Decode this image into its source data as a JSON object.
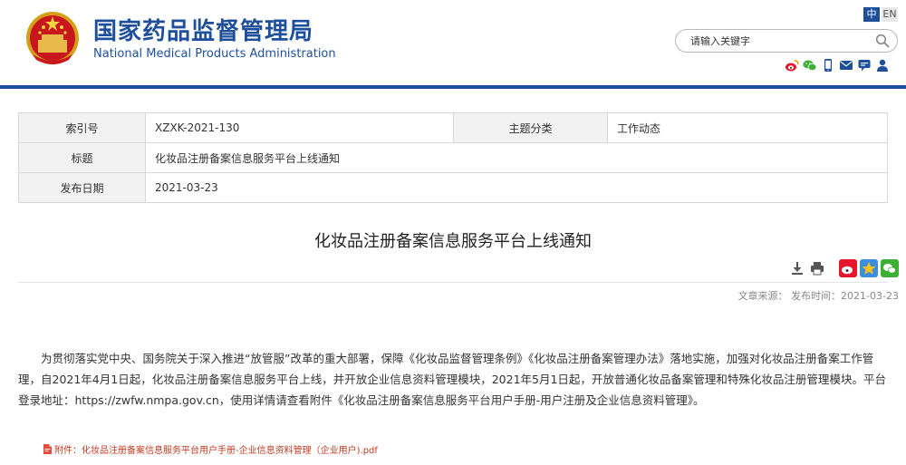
{
  "header": {
    "title_cn": "国家药品监督管理局",
    "title_en": "National Medical Products Administration",
    "lang_zh": "中",
    "lang_en": "EN",
    "search_placeholder": "请输入关键字",
    "social_icons": [
      "weibo-icon",
      "wechat-icon",
      "mobile-icon",
      "mail-icon",
      "feedback-icon",
      "person-icon"
    ]
  },
  "info": {
    "index_label": "索引号",
    "index_value": "XZXK-2021-130",
    "category_label": "主题分类",
    "category_value": "工作动态",
    "title_label": "标题",
    "title_value": "化妆品注册备案信息服务平台上线通知",
    "date_label": "发布日期",
    "date_value": "2021-03-23"
  },
  "article": {
    "title": "化妆品注册备案信息服务平台上线通知",
    "meta": "文章来源：  发布时间：2021-03-23",
    "body": "为贯彻落实党中央、国务院关于深入推进“放管服”改革的重大部署，保障《化妆品监督管理条例》《化妆品注册备案管理办法》落地实施，加强对化妆品注册备案工作管理，自2021年4月1日起，化妆品注册备案信息服务平台上线，并开放企业信息资料管理模块，2021年5月1日起，开放普通化妆品备案管理和特殊化妆品注册管理模块。平台登录地址：https://zwfw.nmpa.gov.cn，使用详情请查看附件《化妆品注册备案信息服务平台用户手册-用户注册及企业信息资料管理》。",
    "attachment": "附件：化妆品注册备案信息服务平台用户手册-企业信息资料管理（企业用户).pdf"
  },
  "colors": {
    "brand_blue": "#1d4f9b",
    "attachment_red": "#c23b22"
  }
}
